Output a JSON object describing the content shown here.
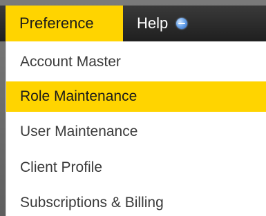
{
  "menubar": {
    "tabs": [
      {
        "label": "Preference",
        "active": true
      },
      {
        "label": "Help",
        "active": false,
        "icon": "help-badge-icon"
      }
    ]
  },
  "dropdown": {
    "items": [
      {
        "label": "Account Master",
        "highlighted": false
      },
      {
        "label": "Role Maintenance",
        "highlighted": true
      },
      {
        "label": "User Maintenance",
        "highlighted": false
      },
      {
        "label": "Client Profile",
        "highlighted": false
      },
      {
        "label": "Subscriptions & Billing",
        "highlighted": false
      }
    ]
  },
  "colors": {
    "accent": "#ffd400",
    "menubar": "#2a2a2a",
    "text": "#3a3a3a"
  }
}
